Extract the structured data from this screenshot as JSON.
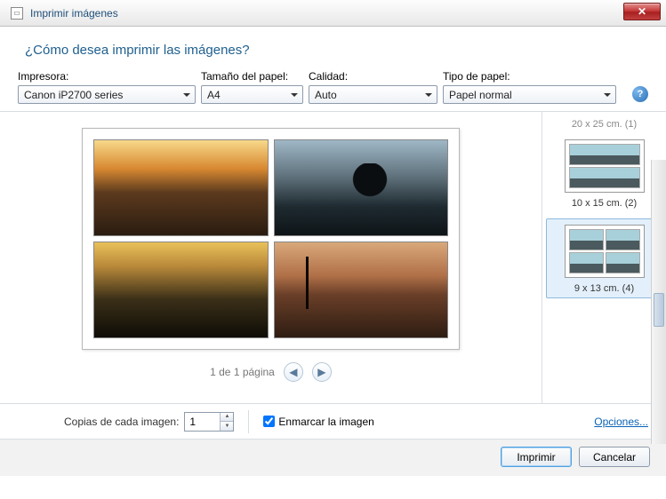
{
  "titlebar": {
    "title": "Imprimir imágenes"
  },
  "header": {
    "question": "¿Cómo desea imprimir las imágenes?"
  },
  "controls": {
    "printer": {
      "label": "Impresora:",
      "value": "Canon iP2700 series"
    },
    "paper_size": {
      "label": "Tamaño del papel:",
      "value": "A4"
    },
    "quality": {
      "label": "Calidad:",
      "value": "Auto"
    },
    "paper_type": {
      "label": "Tipo de papel:",
      "value": "Papel normal"
    }
  },
  "pager": {
    "text": "1 de 1 página"
  },
  "layouts": {
    "cutoff": "20 x 25 cm. (1)",
    "items": [
      {
        "label": "10 x 15 cm. (2)"
      },
      {
        "label": "9 x 13 cm. (4)"
      }
    ]
  },
  "copies": {
    "label": "Copias de cada imagen:",
    "value": "1"
  },
  "frame": {
    "label": "Enmarcar la imagen",
    "checked": true
  },
  "options_link": "Opciones...",
  "buttons": {
    "print": "Imprimir",
    "cancel": "Cancelar"
  }
}
